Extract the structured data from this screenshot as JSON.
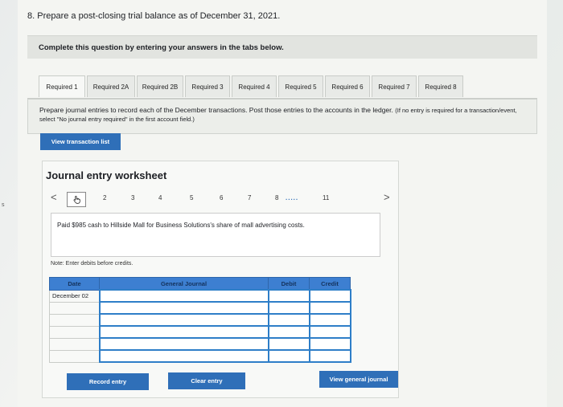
{
  "question": {
    "title": "8. Prepare a post-closing trial balance as of December 31, 2021."
  },
  "instruction": "Complete this question by entering your answers in the tabs below.",
  "tabs": [
    {
      "label": "Required 1",
      "active": true
    },
    {
      "label": "Required 2A"
    },
    {
      "label": "Required 2B"
    },
    {
      "label": "Required 3"
    },
    {
      "label": "Required 4"
    },
    {
      "label": "Required 5"
    },
    {
      "label": "Required 6"
    },
    {
      "label": "Required 7"
    },
    {
      "label": "Required 8"
    }
  ],
  "prompt": {
    "text": "Prepare journal entries to record each of the December transactions. Post those entries to the accounts in the ledger.",
    "note": "(If no entry is required for a transaction/event, select \"No journal entry required\" in the first account field.)"
  },
  "view_transaction_list_label": "View transaction list",
  "worksheet": {
    "title": "Journal entry worksheet",
    "pager": {
      "prev": "<",
      "current_icon": "hand-pointer-icon",
      "pages": [
        "2",
        "3",
        "4",
        "5",
        "6",
        "7",
        "8"
      ],
      "dots": ".....",
      "last": "11",
      "next": ">"
    },
    "description": "Paid $985 cash to Hillside Mall for Business Solutions's share of mall advertising costs.",
    "note": "Note: Enter debits before credits.",
    "table": {
      "headers": {
        "date": "Date",
        "journal": "General Journal",
        "debit": "Debit",
        "credit": "Credit"
      },
      "rows": [
        {
          "date": "December 02",
          "journal": "",
          "debit": "",
          "credit": ""
        },
        {
          "date": "",
          "journal": "",
          "debit": "",
          "credit": ""
        },
        {
          "date": "",
          "journal": "",
          "debit": "",
          "credit": ""
        },
        {
          "date": "",
          "journal": "",
          "debit": "",
          "credit": ""
        },
        {
          "date": "",
          "journal": "",
          "debit": "",
          "credit": ""
        },
        {
          "date": "",
          "journal": "",
          "debit": "",
          "credit": ""
        }
      ]
    },
    "buttons": {
      "record": "Record entry",
      "clear": "Clear entry",
      "view_journal": "View general journal"
    }
  },
  "margin_text": "s",
  "colors": {
    "accent": "#2f6fb8",
    "table_header": "#3d7fd1"
  }
}
